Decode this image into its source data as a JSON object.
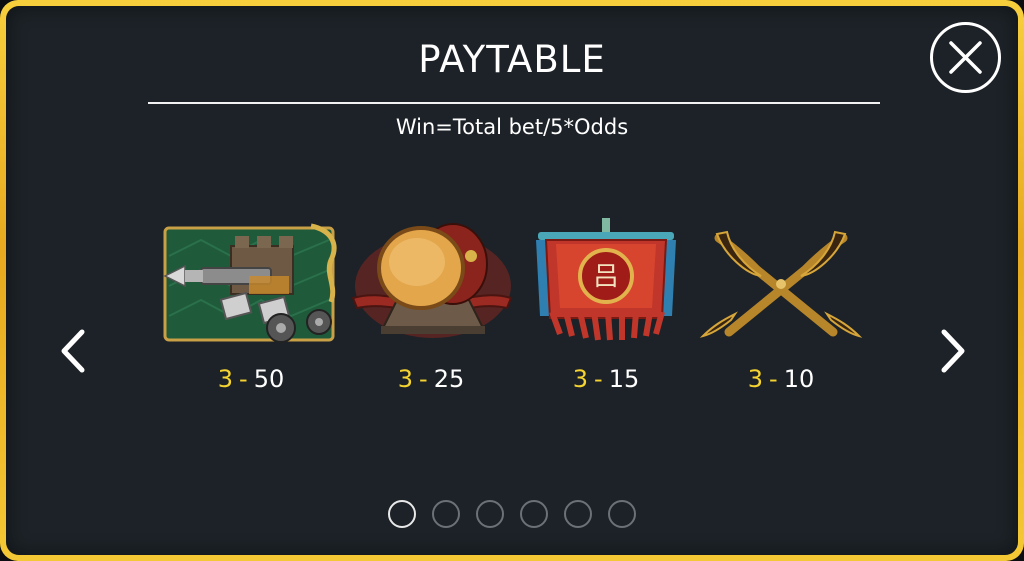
{
  "header": {
    "title": "PAYTABLE",
    "formula": "Win=Total bet/5*Odds"
  },
  "close_button": {
    "icon": "close-icon"
  },
  "navigation": {
    "prev_icon": "chevron-left-icon",
    "next_icon": "chevron-right-icon"
  },
  "symbols": [
    {
      "name": "catapult",
      "count": "3",
      "dash": "-",
      "odds": "50"
    },
    {
      "name": "war-drum",
      "count": "3",
      "dash": "-",
      "odds": "25"
    },
    {
      "name": "battle-banner",
      "count": "3",
      "dash": "-",
      "odds": "15"
    },
    {
      "name": "crossed-swords",
      "count": "3",
      "dash": "-",
      "odds": "10"
    }
  ],
  "pagination": {
    "total_pages": 6,
    "current_page": 1
  },
  "colors": {
    "frame_gold": "#f4c834",
    "panel_bg": "#1c2227",
    "count_yellow": "#f5d330",
    "text_white": "#ffffff"
  }
}
